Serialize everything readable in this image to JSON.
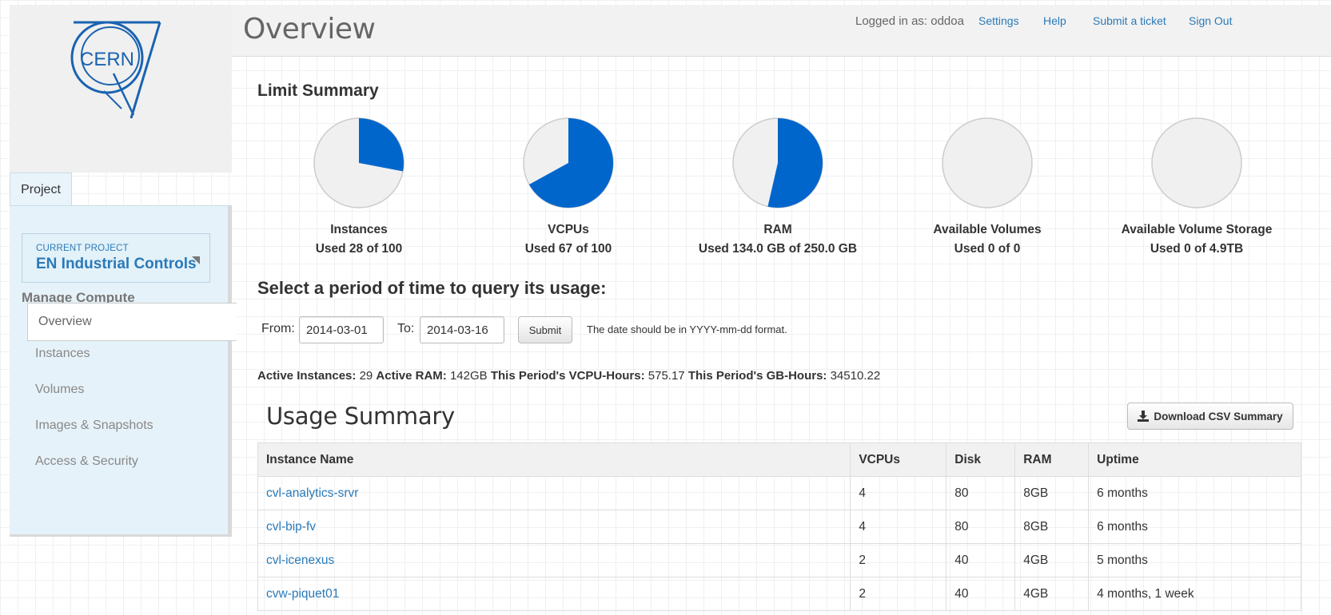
{
  "header": {
    "title": "Overview",
    "user_label": "Logged in as: oddoa",
    "links": [
      "Settings",
      "Help",
      "Submit a ticket",
      "Sign Out"
    ]
  },
  "sidebar": {
    "logo_text": "CERN",
    "tab": "Project",
    "current_project_label": "CURRENT PROJECT",
    "current_project_name": "EN Industrial Controls",
    "section": "Manage Compute",
    "items": [
      "Overview",
      "Instances",
      "Volumes",
      "Images & Snapshots",
      "Access & Security"
    ],
    "active_item": "Overview"
  },
  "limits": {
    "heading": "Limit Summary",
    "colors": {
      "used": "#0066cc",
      "free": "#f0f0f0",
      "border": "#cccccc"
    },
    "items": [
      {
        "title": "Instances",
        "subtitle": "Used 28 of 100",
        "fraction": 0.28
      },
      {
        "title": "VCPUs",
        "subtitle": "Used 67 of 100",
        "fraction": 0.67
      },
      {
        "title": "RAM",
        "subtitle": "Used 134.0 GB of 250.0 GB",
        "fraction": 0.536
      },
      {
        "title": "Available Volumes",
        "subtitle": "Used 0 of 0",
        "fraction": 0
      },
      {
        "title": "Available Volume Storage",
        "subtitle": "Used 0 of 4.9TB",
        "fraction": 0
      }
    ]
  },
  "period": {
    "heading": "Select a period of time to query its usage:",
    "from_label": "From:",
    "from_value": "2014-03-01",
    "to_label": "To:",
    "to_value": "2014-03-16",
    "submit_label": "Submit",
    "hint": "The date should be in YYYY-mm-dd format."
  },
  "stats": {
    "active_instances_label": "Active Instances:",
    "active_instances": "29",
    "active_ram_label": "Active RAM:",
    "active_ram": "142GB",
    "vcpu_hours_label": "This Period's VCPU-Hours:",
    "vcpu_hours": "575.17",
    "gb_hours_label": "This Period's GB-Hours:",
    "gb_hours": "34510.22"
  },
  "usage": {
    "heading": "Usage Summary",
    "download_label": "Download CSV Summary",
    "download_icon": "download-icon",
    "columns": [
      "Instance Name",
      "VCPUs",
      "Disk",
      "RAM",
      "Uptime"
    ],
    "rows": [
      [
        "cvl-analytics-srvr",
        "4",
        "80",
        "8GB",
        "6 months"
      ],
      [
        "cvl-bip-fv",
        "4",
        "80",
        "8GB",
        "6 months"
      ],
      [
        "cvl-icenexus",
        "2",
        "40",
        "4GB",
        "5 months"
      ],
      [
        "cvw-piquet01",
        "2",
        "40",
        "4GB",
        "4 months, 1 week"
      ]
    ]
  }
}
